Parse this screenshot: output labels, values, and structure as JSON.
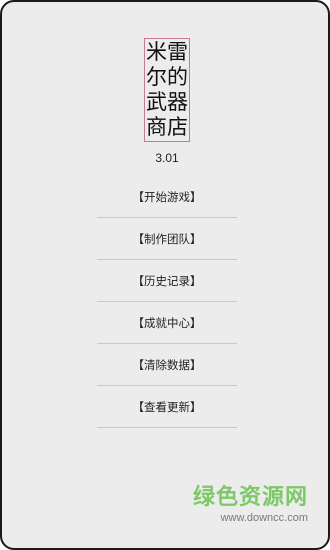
{
  "app": {
    "title": "米雷尔的武器商店",
    "version": "3.01"
  },
  "menu": {
    "items": [
      {
        "id": "start-game",
        "label": "【开始游戏】"
      },
      {
        "id": "credits",
        "label": "【制作团队】"
      },
      {
        "id": "history",
        "label": "【历史记录】"
      },
      {
        "id": "achievements",
        "label": "【成就中心】"
      },
      {
        "id": "clear-data",
        "label": "【清除数据】"
      },
      {
        "id": "check-update",
        "label": "【查看更新】"
      }
    ]
  },
  "watermark": {
    "title": "绿色资源网",
    "url": "www.downcc.com"
  },
  "colors": {
    "background": "#ececec",
    "frame_border": "#1a1a1a",
    "title_border": "#c87a92",
    "separator": "#c9c9c9",
    "watermark_green": "#7ec86a"
  }
}
